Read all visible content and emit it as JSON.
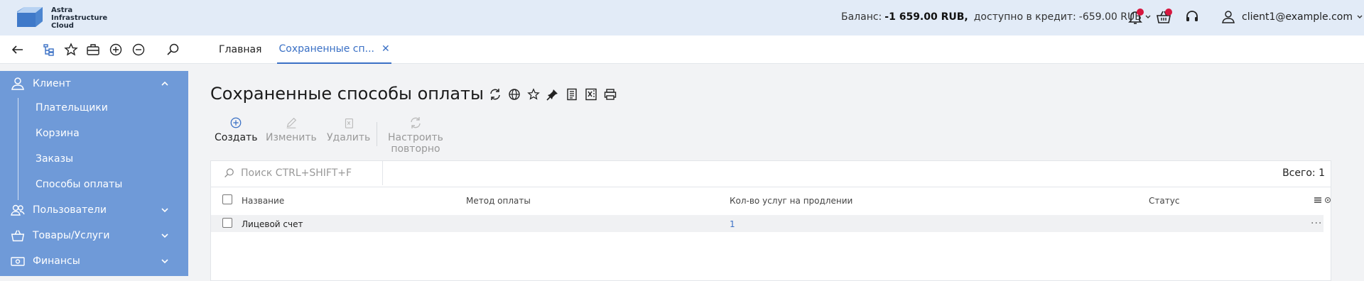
{
  "header": {
    "logo_text": "Astra Infrastructure Cloud",
    "balance_label": "Баланс:",
    "balance_value": "-1 659.00 RUB,",
    "credit_label": "доступно в кредит:",
    "credit_value": "-659.00 RUB",
    "user_email": "client1@example.com"
  },
  "tabs": [
    {
      "label": "Главная"
    },
    {
      "label": "Сохраненные сп...",
      "close": "✕"
    }
  ],
  "sidebar": {
    "client": "Клиент",
    "client_items": [
      "Плательщики",
      "Корзина",
      "Заказы",
      "Способы оплаты"
    ],
    "users": "Пользователи",
    "goods": "Товары/Услуги",
    "finance": "Финансы"
  },
  "page": {
    "title": "Сохраненные способы оплаты",
    "actions": {
      "create": "Создать",
      "edit": "Изменить",
      "delete": "Удалить",
      "reconfigure": "Настроить повторно"
    },
    "search_placeholder": "Поиск CTRL+SHIFT+F",
    "total": "Всего: 1",
    "columns": [
      "Название",
      "Метод оплаты",
      "Кол-во услуг на продлении",
      "Статус"
    ],
    "rows": [
      {
        "name": "Лицевой счет",
        "method": "",
        "count": "1",
        "status": ""
      }
    ]
  },
  "colors": {
    "header_bg": "#e2ebf7",
    "sidebar_bg": "#6f9ad8",
    "accent": "#3a70c5",
    "badge": "#d6173f"
  }
}
